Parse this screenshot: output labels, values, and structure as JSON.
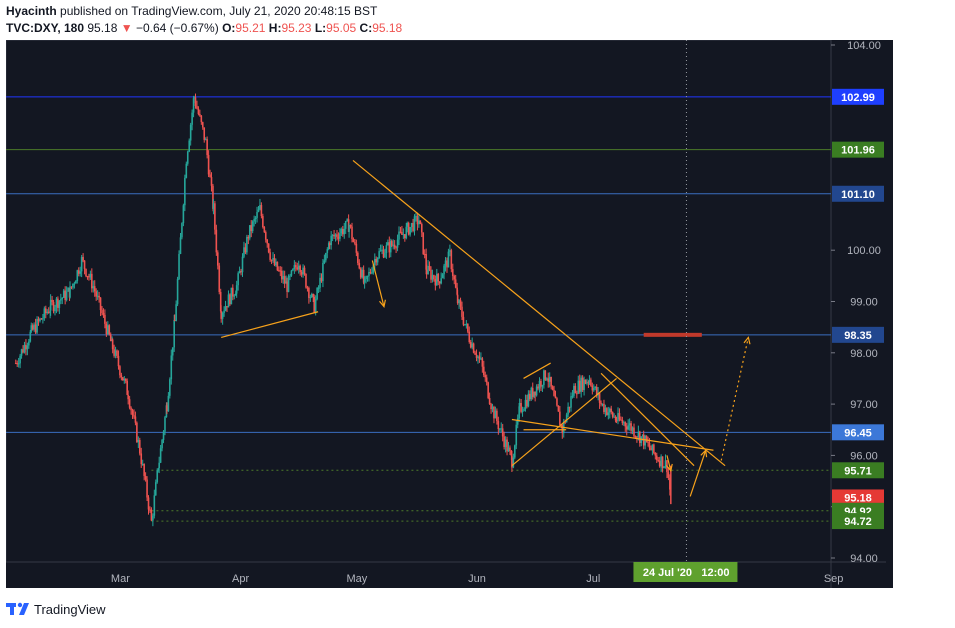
{
  "header": {
    "author": "Hyacinth",
    "published": "published on TradingView.com, July 21, 2020 20:48:15 BST",
    "symbol": "TVC:DXY, 180",
    "last": "95.18",
    "change": "−0.64 (−0.67%)",
    "o_label": "O:",
    "o_value": "95.21",
    "h_label": "H:",
    "h_value": "95.23",
    "l_label": "L:",
    "l_value": "95.05",
    "c_label": "C:",
    "c_value": "95.18"
  },
  "footer": {
    "brand": "TradingView"
  },
  "colors": {
    "background": "#131722",
    "up": "#26a69a",
    "down": "#ef5350",
    "trendline": "#f7a21b",
    "level_blue": "#2962ff",
    "level_light": "#3a75c4",
    "level_green": "#4caf50",
    "grid": "#2a2e39"
  },
  "chart_data": {
    "type": "candlestick",
    "title": "TVC:DXY, 180",
    "x_axis_labels": [
      "Mar",
      "Apr",
      "May",
      "Jun",
      "Jul",
      "Sep"
    ],
    "y_axis_ticks": [
      "104.00",
      "99.00",
      "98.00",
      "97.00",
      "100.00",
      "96.00",
      "95.00",
      "94.00"
    ],
    "crosshair_date_label": "24 Jul '20",
    "crosshair_time_label": "12:00",
    "ylim": [
      94.0,
      104.0
    ],
    "price_levels": [
      {
        "value": "102.99",
        "line": "blue"
      },
      {
        "value": "101.96",
        "line": "green"
      },
      {
        "value": "101.10",
        "line": "light-blue"
      },
      {
        "value": "98.35",
        "line": "light-blue"
      },
      {
        "value": "96.45",
        "line": "light-blue"
      },
      {
        "value": "95.71",
        "line": "dotted-green"
      },
      {
        "value": "95.18",
        "line": "last-price"
      },
      {
        "value": "94.92",
        "line": "dotted-green"
      },
      {
        "value": "94.72",
        "line": "dotted-green"
      }
    ],
    "series": [
      {
        "path_points": [
          [
            "2020-02-03",
            97.8
          ],
          [
            "2020-02-07",
            98.4
          ],
          [
            "2020-02-12",
            98.9
          ],
          [
            "2020-02-17",
            99.2
          ],
          [
            "2020-02-20",
            99.8
          ],
          [
            "2020-02-23",
            99.3
          ],
          [
            "2020-02-28",
            98.1
          ],
          [
            "2020-03-03",
            97.2
          ],
          [
            "2020-03-06",
            96.1
          ],
          [
            "2020-03-09",
            94.7
          ],
          [
            "2020-03-11",
            95.9
          ],
          [
            "2020-03-13",
            97.0
          ],
          [
            "2020-03-15",
            98.6
          ],
          [
            "2020-03-18",
            101.8
          ],
          [
            "2020-03-20",
            102.99
          ],
          [
            "2020-03-23",
            102.1
          ],
          [
            "2020-03-25",
            100.8
          ],
          [
            "2020-03-27",
            98.8
          ],
          [
            "2020-03-31",
            99.3
          ],
          [
            "2020-04-03",
            100.3
          ],
          [
            "2020-04-06",
            100.8
          ],
          [
            "2020-04-09",
            99.8
          ],
          [
            "2020-04-13",
            99.3
          ],
          [
            "2020-04-16",
            99.8
          ],
          [
            "2020-04-20",
            98.9
          ],
          [
            "2020-04-24",
            100.2
          ],
          [
            "2020-04-29",
            100.5
          ],
          [
            "2020-05-03",
            99.3
          ],
          [
            "2020-05-06",
            99.9
          ],
          [
            "2020-05-10",
            100.1
          ],
          [
            "2020-05-14",
            100.4
          ],
          [
            "2020-05-17",
            100.6
          ],
          [
            "2020-05-19",
            99.6
          ],
          [
            "2020-05-22",
            99.4
          ],
          [
            "2020-05-25",
            99.9
          ],
          [
            "2020-05-27",
            99.0
          ],
          [
            "2020-05-30",
            98.3
          ],
          [
            "2020-06-02",
            97.8
          ],
          [
            "2020-06-05",
            96.9
          ],
          [
            "2020-06-08",
            96.3
          ],
          [
            "2020-06-10",
            95.9
          ],
          [
            "2020-06-12",
            96.9
          ],
          [
            "2020-06-16",
            97.3
          ],
          [
            "2020-06-19",
            97.6
          ],
          [
            "2020-06-23",
            96.5
          ],
          [
            "2020-06-26",
            97.3
          ],
          [
            "2020-06-30",
            97.5
          ],
          [
            "2020-07-03",
            97.0
          ],
          [
            "2020-07-07",
            96.7
          ],
          [
            "2020-07-10",
            96.6
          ],
          [
            "2020-07-14",
            96.3
          ],
          [
            "2020-07-17",
            96.0
          ],
          [
            "2020-07-20",
            95.8
          ],
          [
            "2020-07-21",
            95.18
          ]
        ]
      }
    ]
  }
}
